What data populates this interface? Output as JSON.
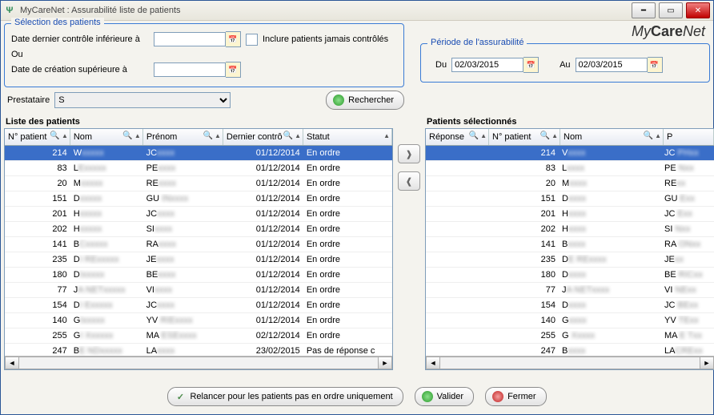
{
  "window": {
    "title": "MyCareNet : Assurabilité liste de patients"
  },
  "brand": {
    "prefix": "My",
    "mid": "Care",
    "suffix": "Net"
  },
  "selection": {
    "legend": "Sélection des patients",
    "date_last_check_label": "Date dernier contrôle inférieure à",
    "or_label": "Ou",
    "date_creation_label": "Date de création supérieure à",
    "include_never_label": "Inclure patients jamais contrôlés",
    "prestataire_label": "Prestataire",
    "prestataire_value": "S",
    "search_label": "Rechercher"
  },
  "period": {
    "legend": "Période de l'assurabilité",
    "from_label": "Du",
    "from_value": "02/03/2015",
    "to_label": "Au",
    "to_value": "02/03/2015"
  },
  "lists": {
    "left_title": "Liste des patients",
    "right_title": "Patients sélectionnés"
  },
  "left_cols": {
    "c0": "N° patient",
    "c1": "Nom",
    "c2": "Prénom",
    "c3": "Dernier contrô",
    "c4": "Statut"
  },
  "right_cols": {
    "c0": "Réponse",
    "c1": "N° patient",
    "c2": "Nom",
    "c3": "P"
  },
  "left_rows": [
    {
      "num": "214",
      "nom": "W",
      "pre": "JC",
      "date": "01/12/2014",
      "stat": "En ordre",
      "sel": true
    },
    {
      "num": "83",
      "nom": "LE",
      "pre": "PE",
      "date": "01/12/2014",
      "stat": "En ordre"
    },
    {
      "num": "20",
      "nom": "M",
      "pre": "RE",
      "date": "01/12/2014",
      "stat": "En ordre"
    },
    {
      "num": "151",
      "nom": "D",
      "pre": "GU      IN",
      "date": "01/12/2014",
      "stat": "En ordre"
    },
    {
      "num": "201",
      "nom": "H",
      "pre": "JC",
      "date": "01/12/2014",
      "stat": "En ordre"
    },
    {
      "num": "202",
      "nom": "H",
      "pre": "SI",
      "date": "01/12/2014",
      "stat": "En ordre"
    },
    {
      "num": "141",
      "nom": "BC",
      "pre": "RA",
      "date": "01/12/2014",
      "stat": "En ordre"
    },
    {
      "num": "235",
      "nom": "DI    RE",
      "pre": "JE",
      "date": "01/12/2014",
      "stat": "En ordre"
    },
    {
      "num": "180",
      "nom": "DI",
      "pre": "BE",
      "date": "01/12/2014",
      "stat": "En ordre"
    },
    {
      "num": "77",
      "nom": "JA    NET",
      "pre": "VI",
      "date": "01/12/2014",
      "stat": "En ordre"
    },
    {
      "num": "154",
      "nom": "DI    E",
      "pre": "JC",
      "date": "01/12/2014",
      "stat": "En ordre"
    },
    {
      "num": "140",
      "nom": "GI",
      "pre": "YV     RIE",
      "date": "01/12/2014",
      "stat": "En ordre"
    },
    {
      "num": "255",
      "nom": "GI    X",
      "pre": "MA   ESE",
      "date": "02/12/2014",
      "stat": "En ordre"
    },
    {
      "num": "247",
      "nom": "BE    ND",
      "pre": "LA",
      "date": "23/02/2015",
      "stat": "Pas de réponse c"
    }
  ],
  "right_rows": [
    {
      "rep": "",
      "num": "214",
      "nom": "V",
      "pre": "JC  PH",
      "sel": true
    },
    {
      "rep": "",
      "num": "83",
      "nom": "L",
      "pre": "PE   N"
    },
    {
      "rep": "",
      "num": "20",
      "nom": "M",
      "pre": "RE"
    },
    {
      "rep": "",
      "num": "151",
      "nom": "D",
      "pre": "GU  E"
    },
    {
      "rep": "",
      "num": "201",
      "nom": "H",
      "pre": "JC   E"
    },
    {
      "rep": "",
      "num": "202",
      "nom": "H",
      "pre": "SI   N"
    },
    {
      "rep": "",
      "num": "141",
      "nom": "B",
      "pre": "RA  ON"
    },
    {
      "rep": "",
      "num": "235",
      "nom": "DE   RE",
      "pre": "JE"
    },
    {
      "rep": "",
      "num": "180",
      "nom": "D",
      "pre": "BE  RIC"
    },
    {
      "rep": "",
      "num": "77",
      "nom": "JA   NET",
      "pre": "VI   NE"
    },
    {
      "rep": "",
      "num": "154",
      "nom": "D",
      "pre": "JC  BE"
    },
    {
      "rep": "",
      "num": "140",
      "nom": "G",
      "pre": "YV  TE"
    },
    {
      "rep": "",
      "num": "255",
      "nom": "G     X",
      "pre": "MA  E T"
    },
    {
      "rep": "",
      "num": "247",
      "nom": "B",
      "pre": "LACRE"
    }
  ],
  "footer": {
    "relancer": "Relancer pour les patients pas en ordre uniquement",
    "valider": "Valider",
    "fermer": "Fermer"
  }
}
